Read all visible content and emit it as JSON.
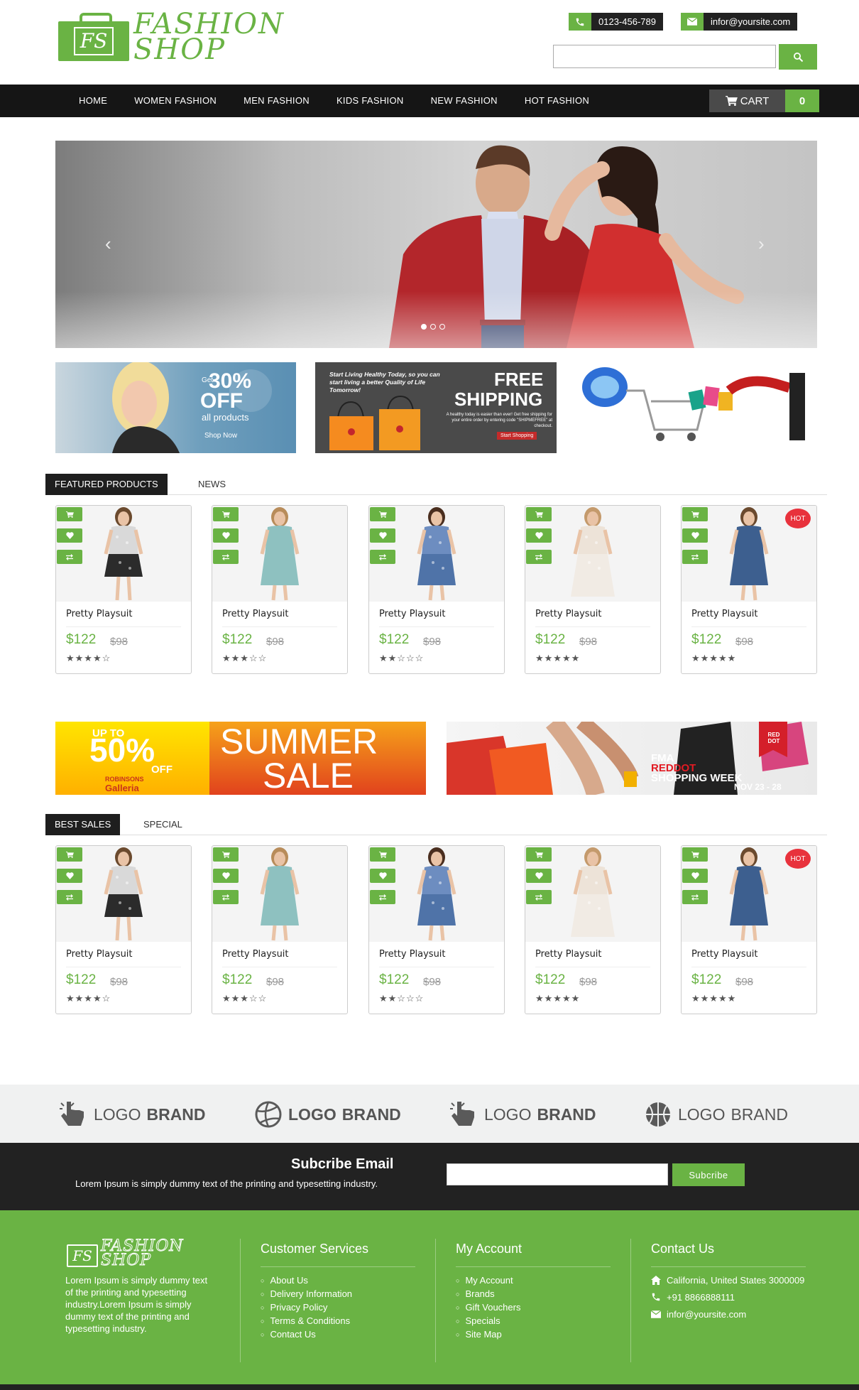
{
  "header": {
    "logo_initials": "FS",
    "logo_line1": "FASHION",
    "logo_line2": "SHOP",
    "phone": "0123-456-789",
    "email": "infor@yoursite.com",
    "search_placeholder": ""
  },
  "nav": {
    "items": [
      "HOME",
      "WOMEN FASHION",
      "MEN FASHION",
      "KIDS FASHION",
      "NEW FASHION",
      "HOT FASHION"
    ],
    "cart_label": "CART",
    "cart_count": "0"
  },
  "promo": {
    "b1_pre": "Get",
    "b1_big": "30%",
    "b1_off": "OFF",
    "b1_all": "all products",
    "b1_shop": "Shop Now",
    "b2_italic": "Start Living Healthy Today, so you can start living a better Quality of Life Tomorrow!",
    "b2_big1": "FREE",
    "b2_big2": "SHIPPING",
    "b2_small": "A healthy today is easier than ever! Get free shipping for your entire order by entering code \"SHIPMEFREE\" at checkout.",
    "b2_btn": "Start Shopping"
  },
  "tabs1": {
    "active": "FEATURED PRODUCTS",
    "other": "NEWS"
  },
  "tabs2": {
    "active": "BEST SALES",
    "other": "SPECIAL"
  },
  "products": [
    {
      "name": "Pretty Playsuit",
      "price": "$122",
      "old": "$98",
      "stars": "★★★★☆",
      "hot": ""
    },
    {
      "name": "Pretty Playsuit",
      "price": "$122",
      "old": "$98",
      "stars": "★★★☆☆",
      "hot": ""
    },
    {
      "name": "Pretty Playsuit",
      "price": "$122",
      "old": "$98",
      "stars": "★★☆☆☆",
      "hot": ""
    },
    {
      "name": "Pretty Playsuit",
      "price": "$122",
      "old": "$98",
      "stars": "★★★★★",
      "hot": ""
    },
    {
      "name": "Pretty Playsuit",
      "price": "$122",
      "old": "$98",
      "stars": "★★★★★",
      "hot": "HOT"
    }
  ],
  "sale_banners": {
    "s1_upto": "UP TO",
    "s1_pct": "50%",
    "s1_off": "OFF",
    "s1_brand1": "ROBINSONS",
    "s1_brand2": "Galleria",
    "s1_big1": "SUMMER",
    "s1_big2": "SALE",
    "s2_l1": "FMA",
    "s2_l2": "REDDOT",
    "s2_l3": "SHOPPING WEEK",
    "s2_l4": "NOV 23 - 28",
    "s2_tag": "RED DOT"
  },
  "brands": [
    {
      "light": "LOGO",
      "bold": "BRAND"
    },
    {
      "light": "LOGO",
      "bold": "BRAND"
    },
    {
      "light": "LOGO",
      "bold": "BRAND"
    },
    {
      "light": "LOGO",
      "bold": "BRAND"
    }
  ],
  "subscribe": {
    "title": "Subcribe Email",
    "text": "Lorem Ipsum is simply dummy text of the printing and typesetting industry.",
    "button": "Subcribe"
  },
  "footer": {
    "about": "Lorem Ipsum is simply dummy text of the printing and typesetting industry.Lorem Ipsum is simply dummy text of the printing and typesetting industry.",
    "cs_title": "Customer Services",
    "cs_items": [
      "About Us",
      "Delivery Information",
      "Privacy Policy",
      "Terms & Conditions",
      "Contact Us"
    ],
    "acc_title": "My Account",
    "acc_items": [
      "My Account",
      "Brands",
      "Gift Vouchers",
      "Specials",
      "Site Map"
    ],
    "contact_title": "Contact Us",
    "address": "California, United States 3000009",
    "phone": "+91 8866888111",
    "email": "infor@yoursite.com"
  },
  "colors": {
    "accent": "#6ab344",
    "dark": "#151515",
    "hot": "#e8323c"
  }
}
